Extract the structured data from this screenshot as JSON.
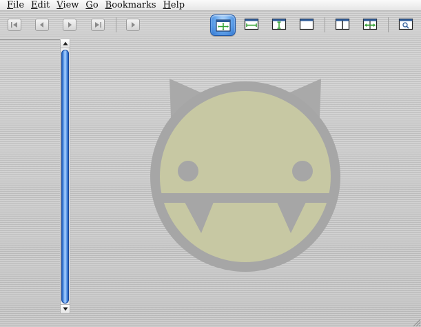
{
  "menubar": {
    "items": [
      {
        "mnemonic": "F",
        "rest": "ile"
      },
      {
        "mnemonic": "E",
        "rest": "dit"
      },
      {
        "mnemonic": "V",
        "rest": "iew"
      },
      {
        "mnemonic": "G",
        "rest": "o"
      },
      {
        "mnemonic": "B",
        "rest": "ookmarks"
      },
      {
        "mnemonic": "H",
        "rest": "elp"
      }
    ]
  },
  "toolbar": {
    "navigation_icons": [
      "first-page-icon",
      "previous-page-icon",
      "next-page-icon",
      "last-page-icon"
    ],
    "play_icon": "slideshow-play-icon",
    "view_icons": [
      "fit-best-icon",
      "fit-width-icon",
      "fit-height-icon",
      "fit-page-icon",
      "two-pages-icon",
      "continuous-icon",
      "zoom-icon"
    ],
    "active_view": "fit-best-icon"
  },
  "scrollbar": {
    "up_icon": "scroll-up-arrow-icon",
    "down_icon": "scroll-down-arrow-icon"
  },
  "watermark": {
    "icon": "app-logo-devil-icon"
  },
  "colors": {
    "accent_blue": "#3d86dc",
    "watermark_face": "#c4c6a0",
    "watermark_ring": "#a4a4a4"
  }
}
